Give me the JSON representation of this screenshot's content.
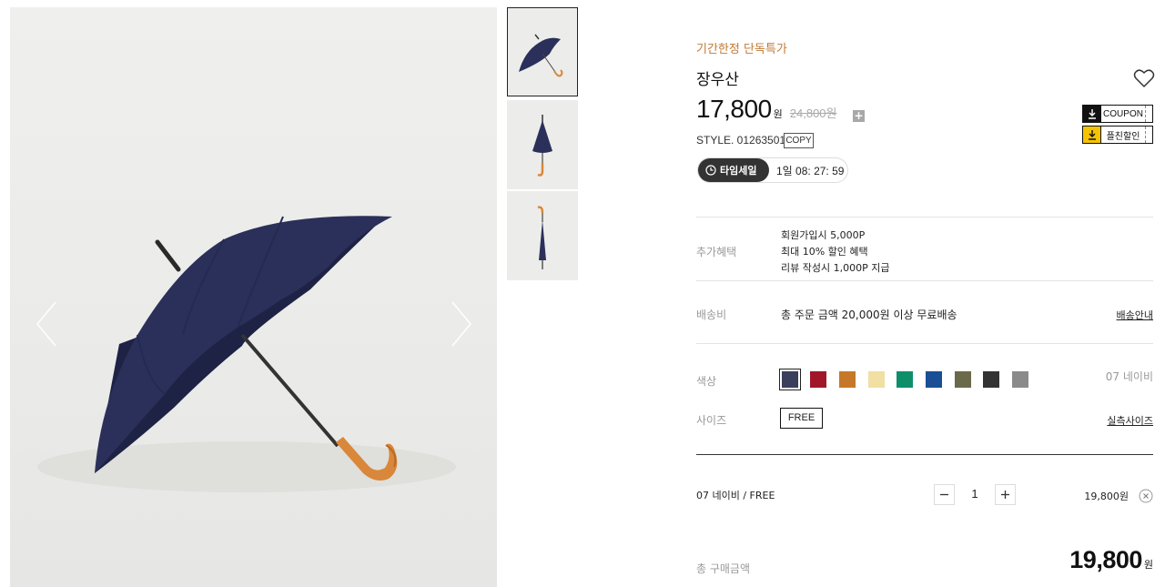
{
  "gallery": {
    "main_image": "navy-long-umbrella-photo",
    "prev_icon": "chevron-left-icon",
    "next_icon": "chevron-right-icon",
    "thumbnails": [
      "umbrella-open-side",
      "umbrella-closed-down",
      "umbrella-closed-hook"
    ]
  },
  "product": {
    "promo_label": "기간한정 단독특가",
    "name": "장우산",
    "price": "17,800",
    "price_unit": "원",
    "original_price": "24,800원",
    "style_label": "STYLE. 01263501",
    "copy_label": "COPY",
    "wishlist_icon": "heart-icon"
  },
  "coupons": {
    "coupon_label": "COUPON",
    "friend_discount_label": "플친할인"
  },
  "timesale": {
    "badge_label": "타임세일",
    "remaining": "1일 08: 27: 59"
  },
  "benefits": {
    "label": "추가혜택",
    "items": [
      "회원가입시 5,000P",
      "최대 10% 할인 혜택",
      "리뷰 작성시 1,000P 지급"
    ]
  },
  "shipping": {
    "label": "배송비",
    "text": "총 주문 금액 20,000원 이상 무료배송",
    "link": "배송안내"
  },
  "color": {
    "label": "색상",
    "selected_name": "07 네이비",
    "swatches": [
      "#3a3f5c",
      "#a0172a",
      "#c7772a",
      "#f1dfa3",
      "#0e8f6a",
      "#1a4e95",
      "#6a6a4a",
      "#333333",
      "#8a8a8a"
    ]
  },
  "size": {
    "label": "사이즈",
    "value": "FREE",
    "link": "실측사이즈"
  },
  "selection": {
    "option": "07 네이비 / FREE",
    "quantity": "1",
    "line_price": "19,800원"
  },
  "total": {
    "label": "총 구매금액",
    "amount": "19,800",
    "unit": "원"
  },
  "colors": {
    "accent": "#c07a35",
    "navy": "#2b305a"
  }
}
